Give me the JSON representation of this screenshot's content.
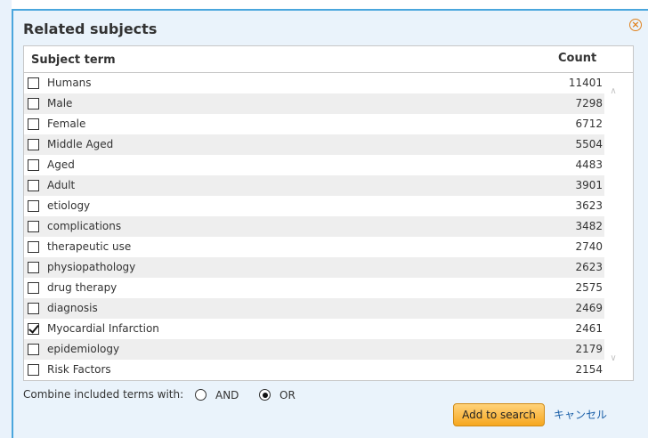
{
  "dialog": {
    "title": "Related subjects",
    "close_icon": "close-circle-icon",
    "accent_color": "#4aa6dd",
    "close_color": "#e0821e"
  },
  "table": {
    "header_term": "Subject term",
    "header_count": "Count",
    "rows": [
      {
        "term": "Humans",
        "count": "11401",
        "checked": false
      },
      {
        "term": "Male",
        "count": "7298",
        "checked": false
      },
      {
        "term": "Female",
        "count": "6712",
        "checked": false
      },
      {
        "term": "Middle Aged",
        "count": "5504",
        "checked": false
      },
      {
        "term": "Aged",
        "count": "4483",
        "checked": false
      },
      {
        "term": "Adult",
        "count": "3901",
        "checked": false
      },
      {
        "term": "etiology",
        "count": "3623",
        "checked": false
      },
      {
        "term": "complications",
        "count": "3482",
        "checked": false
      },
      {
        "term": "therapeutic use",
        "count": "2740",
        "checked": false
      },
      {
        "term": "physiopathology",
        "count": "2623",
        "checked": false
      },
      {
        "term": "drug therapy",
        "count": "2575",
        "checked": false
      },
      {
        "term": "diagnosis",
        "count": "2469",
        "checked": false
      },
      {
        "term": "Myocardial Infarction",
        "count": "2461",
        "checked": true
      },
      {
        "term": "epidemiology",
        "count": "2179",
        "checked": false
      },
      {
        "term": "Risk Factors",
        "count": "2154",
        "checked": false
      }
    ]
  },
  "combine": {
    "label": "Combine included terms with:",
    "options": [
      {
        "label": "AND",
        "selected": false
      },
      {
        "label": "OR",
        "selected": true
      }
    ]
  },
  "actions": {
    "add_label": "Add to search",
    "cancel_label": "キャンセル",
    "add_color": "#f6a71f",
    "cancel_color": "#1a5fa8"
  }
}
